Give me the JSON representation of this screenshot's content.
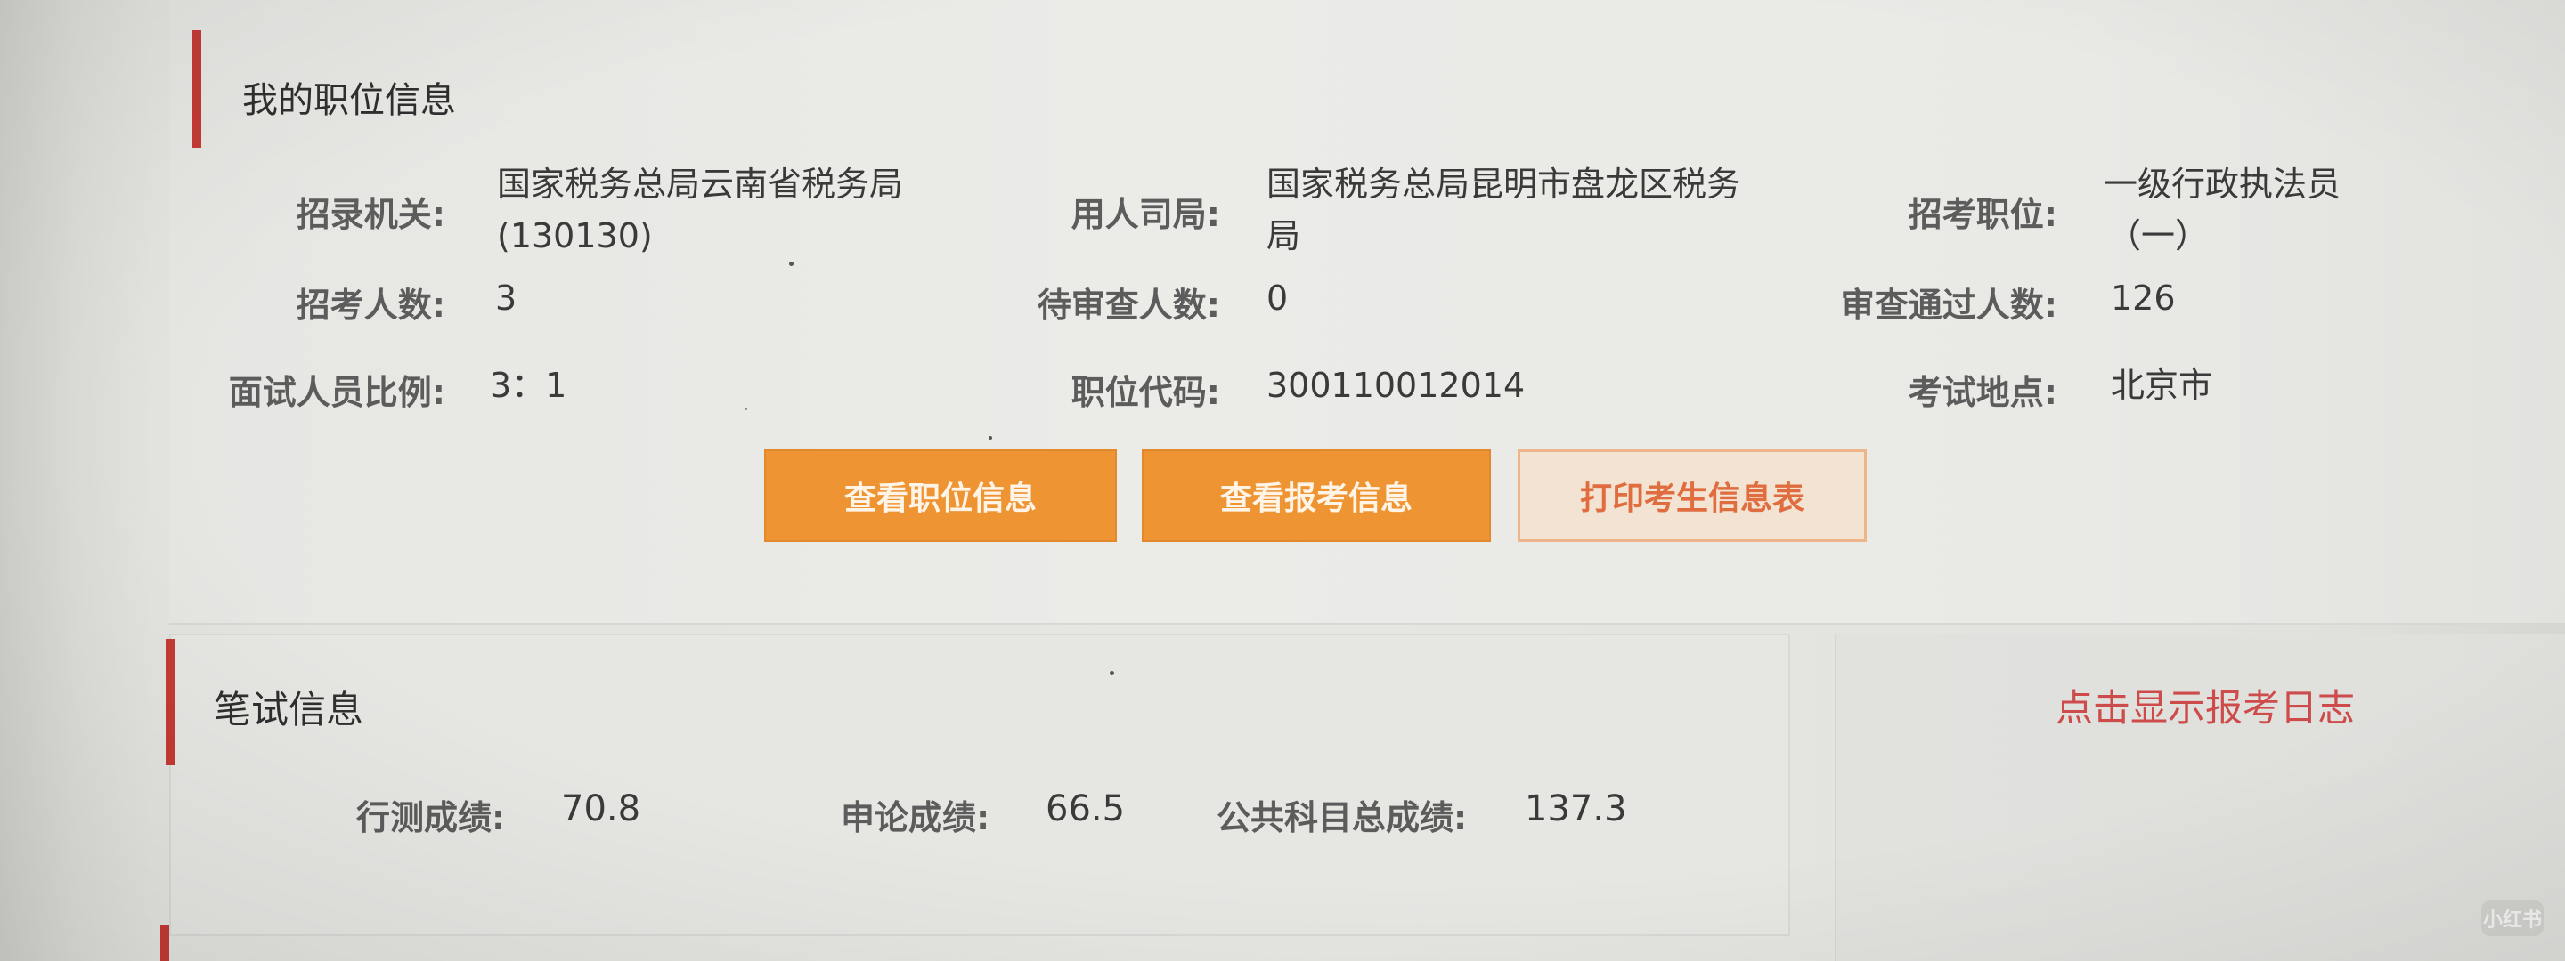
{
  "position_section": {
    "title": "我的职位信息",
    "fields": {
      "agency": {
        "label": "招录机关:",
        "value_line1": "国家税务总局云南省税务局",
        "value_line2": "(130130)"
      },
      "employer": {
        "label": "用人司局:",
        "value_line1": "国家税务总局昆明市盘龙区税务",
        "value_line2": "局"
      },
      "job": {
        "label": "招考职位:",
        "value_line1": "一级行政执法员",
        "value_line2": "（一）"
      },
      "recruit_count": {
        "label": "招考人数:",
        "value": "3"
      },
      "pending_count": {
        "label": "待审查人数:",
        "value": "0"
      },
      "approved_count": {
        "label": "审查通过人数:",
        "value": "126"
      },
      "interview_ratio": {
        "label": "面试人员比例:",
        "value": "3：1"
      },
      "position_code": {
        "label": "职位代码:",
        "value": "300110012014"
      },
      "exam_location": {
        "label": "考试地点:",
        "value": "北京市"
      }
    },
    "buttons": {
      "view_position": "查看职位信息",
      "view_application": "查看报考信息",
      "print_form": "打印考生信息表"
    }
  },
  "written_exam_section": {
    "title": "笔试信息",
    "scores": {
      "xingce": {
        "label": "行测成绩:",
        "value": "70.8"
      },
      "shenlun": {
        "label": "申论成绩:",
        "value": "66.5"
      },
      "total": {
        "label": "公共科目总成绩:",
        "value": "137.3"
      }
    }
  },
  "side_panel": {
    "show_log_link": "点击显示报考日志"
  },
  "watermark": "小红书",
  "colors": {
    "accent_red": "#c43a34",
    "button_orange": "#ee9433",
    "link_red": "#cd4b4b"
  }
}
